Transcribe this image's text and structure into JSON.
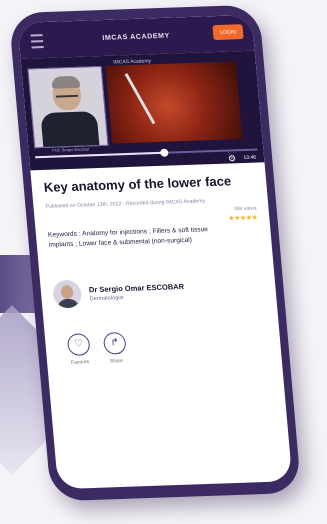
{
  "header": {
    "brand": "IMCAS ACADEMY",
    "login_label": "LOGIN",
    "icons": [
      "menu-icon"
    ]
  },
  "video": {
    "title": "IMCAS Academy",
    "speaker_caption": "Prof. Sergio Escobar",
    "progress": 0.58,
    "duration": "13:46",
    "icons": [
      "gear-icon"
    ]
  },
  "article": {
    "title": "Key anatomy of the lower face",
    "published": "Published on October 13th, 2022 - Recorded during IMCAS Academy",
    "views": "384 views",
    "rating_stars": "★★★★★",
    "keywords": "Keywords : Anatomy for injections ; Fillers & soft tissue implants ; Lower face & submental (non-surgical)"
  },
  "expert": {
    "name": "Dr Sergio Omar ESCOBAR",
    "role": "Dermatologist"
  },
  "actions": {
    "favorite_label": "Favorite",
    "share_label": "Share",
    "favorite_icon": "heart-icon",
    "share_icon": "share-icon"
  },
  "colors": {
    "brand_purple": "#2c1a4e",
    "accent_orange": "#f06a2b",
    "star_gold": "#f1b51e"
  }
}
